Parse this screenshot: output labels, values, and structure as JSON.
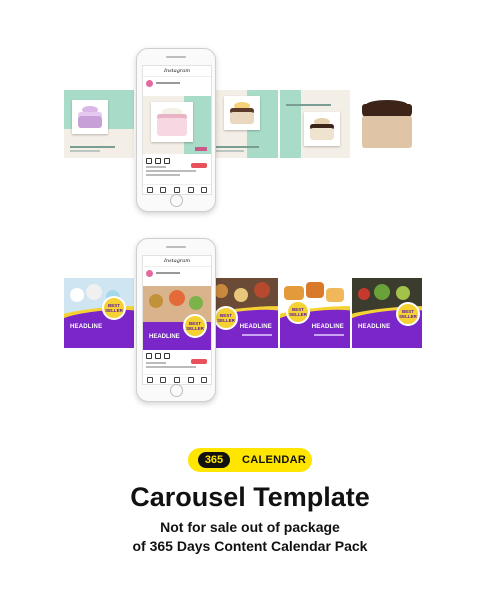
{
  "badge": {
    "number": "365",
    "word": "CALENDAR"
  },
  "title": "Carousel Template",
  "subtitle_lines": [
    "Not for sale out of package",
    "of 365 Days Content Calendar Pack"
  ],
  "phone": {
    "app_name": "Instagram"
  },
  "carousel_2": {
    "headline": "HEADLINE",
    "badge_text": "BEST SELLER"
  },
  "colors": {
    "mint": "#a8dcc8",
    "purple": "#7a26c9",
    "yellow": "#ffe600"
  }
}
